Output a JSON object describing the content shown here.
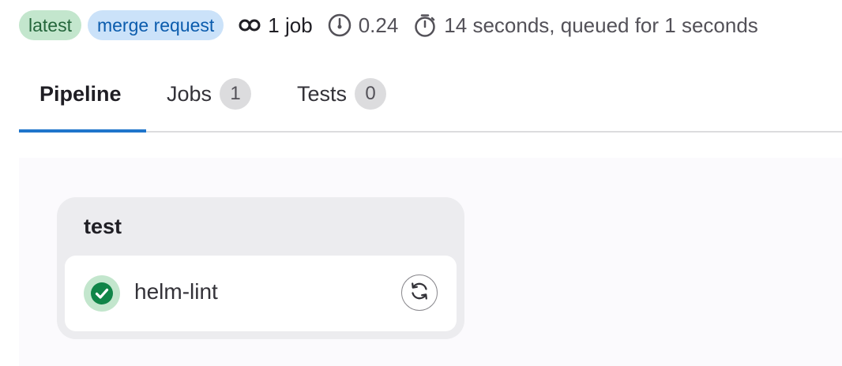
{
  "badges": {
    "latest": "latest",
    "merge_request": "merge request"
  },
  "meta": {
    "jobs": "1 job",
    "coverage": "0.24",
    "duration": "14 seconds, queued for 1 seconds"
  },
  "tabs": [
    {
      "label": "Pipeline",
      "active": true
    },
    {
      "label": "Jobs",
      "count": "1"
    },
    {
      "label": "Tests",
      "count": "0"
    }
  ],
  "stage": {
    "title": "test",
    "jobs": [
      {
        "name": "helm-lint",
        "status": "success",
        "status_icon": "check-circle-icon",
        "action_icon": "retry-icon"
      }
    ]
  },
  "colors": {
    "success": "#108548",
    "tab_active_underline": "#1f75cb",
    "badge_latest_bg": "#c3e6cd",
    "badge_mr_bg": "#cbe2f9"
  }
}
